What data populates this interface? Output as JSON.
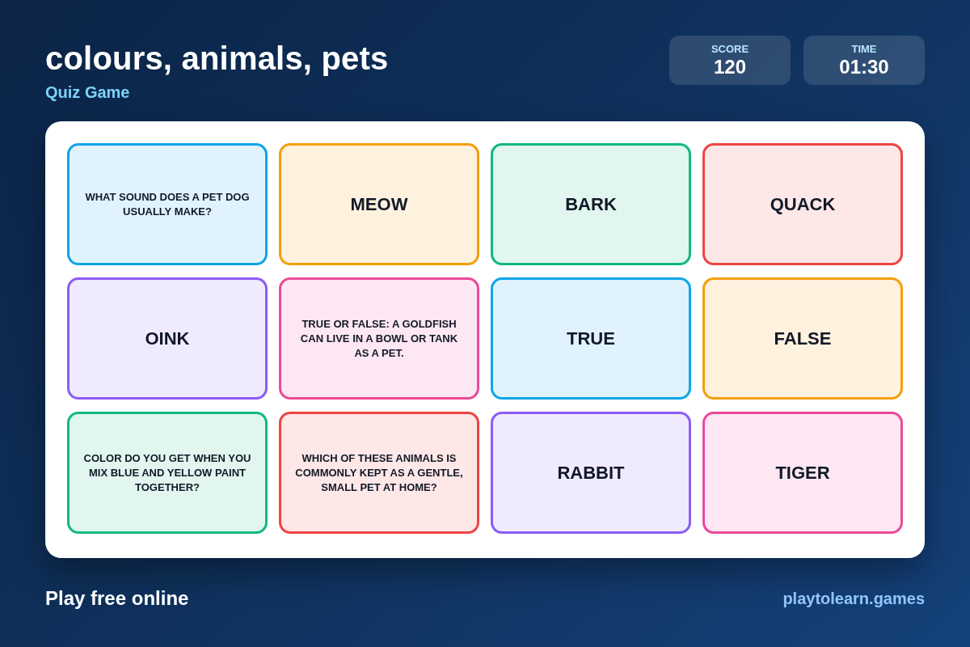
{
  "header": {
    "title": "colours, animals, pets",
    "subtitle": "Quiz Game",
    "stats": [
      {
        "label": "SCORE",
        "value": "120"
      },
      {
        "label": "TIME",
        "value": "01:30"
      }
    ]
  },
  "board": {
    "cards": [
      {
        "kind": "question",
        "text": "WHAT SOUND DOES A PET DOG USUALLY MAKE?",
        "color": "#0ea5e9"
      },
      {
        "kind": "answer",
        "text": "MEOW",
        "color": "#f59e0b"
      },
      {
        "kind": "answer",
        "text": "BARK",
        "color": "#10b981"
      },
      {
        "kind": "answer",
        "text": "QUACK",
        "color": "#ef4444"
      },
      {
        "kind": "answer",
        "text": "OINK",
        "color": "#8b5cf6"
      },
      {
        "kind": "question",
        "text": "TRUE OR FALSE: A GOLDFISH CAN LIVE IN A BOWL OR TANK AS A PET.",
        "color": "#ec4899"
      },
      {
        "kind": "answer",
        "text": "TRUE",
        "color": "#0ea5e9"
      },
      {
        "kind": "answer",
        "text": "FALSE",
        "color": "#f59e0b"
      },
      {
        "kind": "question",
        "text": "COLOR DO YOU GET WHEN YOU MIX BLUE AND YELLOW PAINT TOGETHER?",
        "color": "#10b981"
      },
      {
        "kind": "question",
        "text": "WHICH OF THESE ANIMALS IS COMMONLY KEPT AS A GENTLE, SMALL PET AT HOME?",
        "color": "#ef4444"
      },
      {
        "kind": "answer",
        "text": "RABBIT",
        "color": "#8b5cf6"
      },
      {
        "kind": "answer",
        "text": "TIGER",
        "color": "#ec4899"
      }
    ]
  },
  "footer": {
    "tagline": "Play free online",
    "site": "playtolearn.games"
  }
}
